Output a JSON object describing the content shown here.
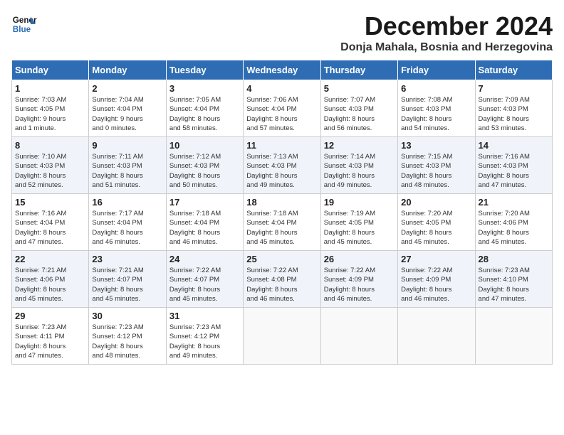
{
  "logo": {
    "line1": "General",
    "line2": "Blue"
  },
  "title": "December 2024",
  "subtitle": "Donja Mahala, Bosnia and Herzegovina",
  "days_of_week": [
    "Sunday",
    "Monday",
    "Tuesday",
    "Wednesday",
    "Thursday",
    "Friday",
    "Saturday"
  ],
  "weeks": [
    [
      {
        "day": "1",
        "info": "Sunrise: 7:03 AM\nSunset: 4:05 PM\nDaylight: 9 hours\nand 1 minute."
      },
      {
        "day": "2",
        "info": "Sunrise: 7:04 AM\nSunset: 4:04 PM\nDaylight: 9 hours\nand 0 minutes."
      },
      {
        "day": "3",
        "info": "Sunrise: 7:05 AM\nSunset: 4:04 PM\nDaylight: 8 hours\nand 58 minutes."
      },
      {
        "day": "4",
        "info": "Sunrise: 7:06 AM\nSunset: 4:04 PM\nDaylight: 8 hours\nand 57 minutes."
      },
      {
        "day": "5",
        "info": "Sunrise: 7:07 AM\nSunset: 4:03 PM\nDaylight: 8 hours\nand 56 minutes."
      },
      {
        "day": "6",
        "info": "Sunrise: 7:08 AM\nSunset: 4:03 PM\nDaylight: 8 hours\nand 54 minutes."
      },
      {
        "day": "7",
        "info": "Sunrise: 7:09 AM\nSunset: 4:03 PM\nDaylight: 8 hours\nand 53 minutes."
      }
    ],
    [
      {
        "day": "8",
        "info": "Sunrise: 7:10 AM\nSunset: 4:03 PM\nDaylight: 8 hours\nand 52 minutes."
      },
      {
        "day": "9",
        "info": "Sunrise: 7:11 AM\nSunset: 4:03 PM\nDaylight: 8 hours\nand 51 minutes."
      },
      {
        "day": "10",
        "info": "Sunrise: 7:12 AM\nSunset: 4:03 PM\nDaylight: 8 hours\nand 50 minutes."
      },
      {
        "day": "11",
        "info": "Sunrise: 7:13 AM\nSunset: 4:03 PM\nDaylight: 8 hours\nand 49 minutes."
      },
      {
        "day": "12",
        "info": "Sunrise: 7:14 AM\nSunset: 4:03 PM\nDaylight: 8 hours\nand 49 minutes."
      },
      {
        "day": "13",
        "info": "Sunrise: 7:15 AM\nSunset: 4:03 PM\nDaylight: 8 hours\nand 48 minutes."
      },
      {
        "day": "14",
        "info": "Sunrise: 7:16 AM\nSunset: 4:03 PM\nDaylight: 8 hours\nand 47 minutes."
      }
    ],
    [
      {
        "day": "15",
        "info": "Sunrise: 7:16 AM\nSunset: 4:04 PM\nDaylight: 8 hours\nand 47 minutes."
      },
      {
        "day": "16",
        "info": "Sunrise: 7:17 AM\nSunset: 4:04 PM\nDaylight: 8 hours\nand 46 minutes."
      },
      {
        "day": "17",
        "info": "Sunrise: 7:18 AM\nSunset: 4:04 PM\nDaylight: 8 hours\nand 46 minutes."
      },
      {
        "day": "18",
        "info": "Sunrise: 7:18 AM\nSunset: 4:04 PM\nDaylight: 8 hours\nand 45 minutes."
      },
      {
        "day": "19",
        "info": "Sunrise: 7:19 AM\nSunset: 4:05 PM\nDaylight: 8 hours\nand 45 minutes."
      },
      {
        "day": "20",
        "info": "Sunrise: 7:20 AM\nSunset: 4:05 PM\nDaylight: 8 hours\nand 45 minutes."
      },
      {
        "day": "21",
        "info": "Sunrise: 7:20 AM\nSunset: 4:06 PM\nDaylight: 8 hours\nand 45 minutes."
      }
    ],
    [
      {
        "day": "22",
        "info": "Sunrise: 7:21 AM\nSunset: 4:06 PM\nDaylight: 8 hours\nand 45 minutes."
      },
      {
        "day": "23",
        "info": "Sunrise: 7:21 AM\nSunset: 4:07 PM\nDaylight: 8 hours\nand 45 minutes."
      },
      {
        "day": "24",
        "info": "Sunrise: 7:22 AM\nSunset: 4:07 PM\nDaylight: 8 hours\nand 45 minutes."
      },
      {
        "day": "25",
        "info": "Sunrise: 7:22 AM\nSunset: 4:08 PM\nDaylight: 8 hours\nand 46 minutes."
      },
      {
        "day": "26",
        "info": "Sunrise: 7:22 AM\nSunset: 4:09 PM\nDaylight: 8 hours\nand 46 minutes."
      },
      {
        "day": "27",
        "info": "Sunrise: 7:22 AM\nSunset: 4:09 PM\nDaylight: 8 hours\nand 46 minutes."
      },
      {
        "day": "28",
        "info": "Sunrise: 7:23 AM\nSunset: 4:10 PM\nDaylight: 8 hours\nand 47 minutes."
      }
    ],
    [
      {
        "day": "29",
        "info": "Sunrise: 7:23 AM\nSunset: 4:11 PM\nDaylight: 8 hours\nand 47 minutes."
      },
      {
        "day": "30",
        "info": "Sunrise: 7:23 AM\nSunset: 4:12 PM\nDaylight: 8 hours\nand 48 minutes."
      },
      {
        "day": "31",
        "info": "Sunrise: 7:23 AM\nSunset: 4:12 PM\nDaylight: 8 hours\nand 49 minutes."
      },
      null,
      null,
      null,
      null
    ]
  ]
}
